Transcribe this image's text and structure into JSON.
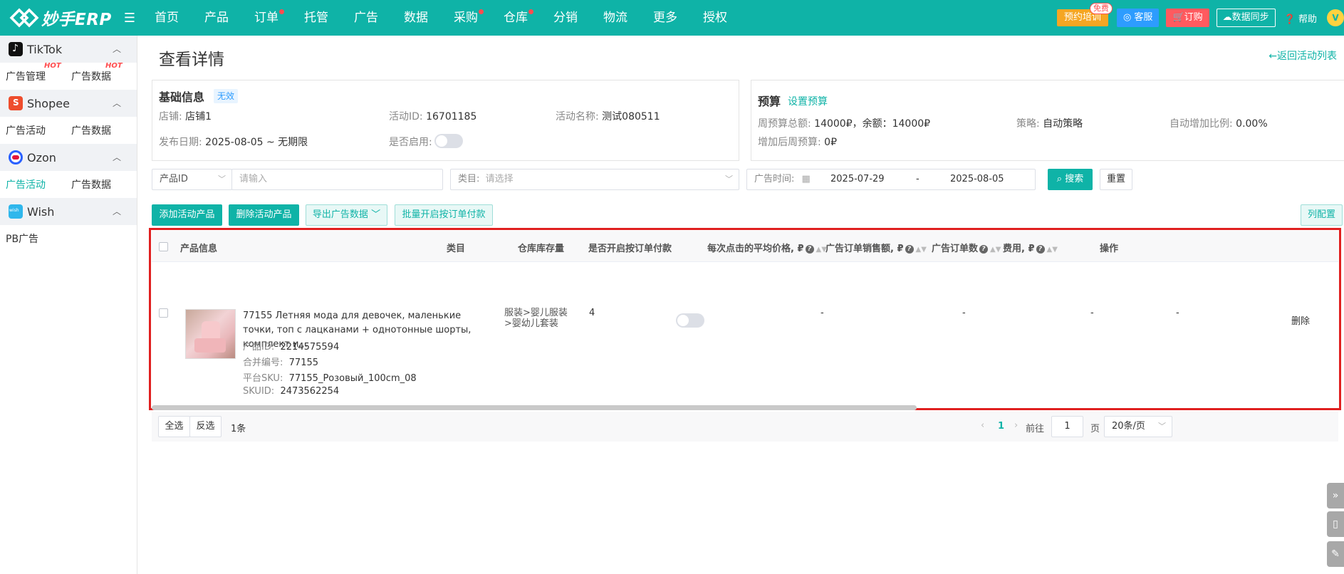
{
  "app": {
    "logo_text": "妙手ERP"
  },
  "nav": {
    "items": [
      {
        "label": "首页",
        "dot": false
      },
      {
        "label": "产品",
        "dot": false
      },
      {
        "label": "订单",
        "dot": true
      },
      {
        "label": "托管",
        "dot": false
      },
      {
        "label": "广告",
        "dot": false
      },
      {
        "label": "数据",
        "dot": false
      },
      {
        "label": "采购",
        "dot": true
      },
      {
        "label": "仓库",
        "dot": true
      },
      {
        "label": "分销",
        "dot": false
      },
      {
        "label": "物流",
        "dot": false
      },
      {
        "label": "更多",
        "dot": false
      },
      {
        "label": "授权",
        "dot": false
      }
    ],
    "training_label": "预约培训",
    "free_badge": "免费",
    "service_label": "客服",
    "order_label": "订购",
    "sync_label": "数据同步",
    "help_label": "帮助",
    "avatar_letter": "V"
  },
  "sidebar": {
    "groups": [
      {
        "name": "TikTok",
        "icon": "tiktok-icon",
        "items": [
          {
            "label": "广告管理",
            "hot": "HOT"
          },
          {
            "label": "广告数据",
            "hot": "HOT"
          }
        ]
      },
      {
        "name": "Shopee",
        "icon": "shopee-icon",
        "items": [
          {
            "label": "广告活动"
          },
          {
            "label": "广告数据"
          }
        ]
      },
      {
        "name": "Ozon",
        "icon": "ozon-icon",
        "items": [
          {
            "label": "广告活动",
            "active": true
          },
          {
            "label": "广告数据"
          }
        ]
      },
      {
        "name": "Wish",
        "icon": "wish-icon",
        "items": [
          {
            "label": "PB广告"
          }
        ]
      }
    ]
  },
  "page": {
    "title": "查看详情",
    "back_link": "←返回活动列表"
  },
  "basic_info": {
    "title": "基础信息",
    "status_tag": "无效",
    "shop_label": "店铺:",
    "shop_value": "店铺1",
    "activity_id_label": "活动ID:",
    "activity_id_value": "16701185",
    "activity_name_label": "活动名称:",
    "activity_name_value": "测试080511",
    "publish_date_label": "发布日期:",
    "publish_date_value": "2025-08-05 ~ 无期限",
    "enabled_label": "是否启用:",
    "enabled": false
  },
  "budget": {
    "title": "预算",
    "set_link": "设置预算",
    "weekly_label": "周预算总额:",
    "weekly_value": "14000₽，余额：14000₽",
    "strategy_label": "策略:",
    "strategy_value": "自动策略",
    "auto_ratio_label": "自动增加比例:",
    "auto_ratio_value": "0.00%",
    "after_increase_label": "增加后周预算:",
    "after_increase_value": "0₽"
  },
  "filters": {
    "product_id_select": "产品ID",
    "product_id_placeholder": "请输入",
    "category_label": "类目:",
    "category_placeholder": "请选择",
    "time_label": "广告时间:",
    "date_from": "2025-07-29",
    "date_sep": "-",
    "date_to": "2025-08-05",
    "search_label": "搜索",
    "reset_label": "重置"
  },
  "actions": {
    "add_label": "添加活动产品",
    "delete_label": "删除活动产品",
    "export_label": "导出广告数据",
    "batch_label": "批量开启按订单付款",
    "columns_label": "列配置"
  },
  "table": {
    "headers": {
      "product_info": "产品信息",
      "category": "类目",
      "stock": "仓库库存量",
      "pay_per_order": "是否开启按订单付款",
      "avg_cpc": "每次点击的平均价格, ₽",
      "order_sales": "广告订单销售额, ₽",
      "order_count": "广告订单数",
      "cost": "费用, ₽",
      "actions": "操作"
    },
    "rows": [
      {
        "title": "77155 Летняя мода для девочек, маленькие точки, топ с лацканами + однотонные шорты, комплект и...",
        "product_id_label": "产品ID:",
        "product_id": "2214575594",
        "merge_no_label": "合并编号:",
        "merge_no": "77155",
        "platform_sku_label": "平台SKU:",
        "platform_sku": "77155_Розовый_100cm_08",
        "skuid_label": "SKUID:",
        "skuid": "2473562254",
        "category": "服装>婴儿服装>婴幼儿套装",
        "stock": "4",
        "avg_cpc": "-",
        "order_sales": "-",
        "order_count": "-",
        "cost": "-",
        "action": "删除"
      }
    ]
  },
  "footer": {
    "select_all": "全选",
    "invert": "反选",
    "count": "1条",
    "current_page": "1",
    "goto_label": "前往",
    "goto_value": "1",
    "page_unit": "页",
    "page_size": "20条/页"
  },
  "colors": {
    "brand": "#0fb3a7",
    "danger": "#e02020"
  }
}
